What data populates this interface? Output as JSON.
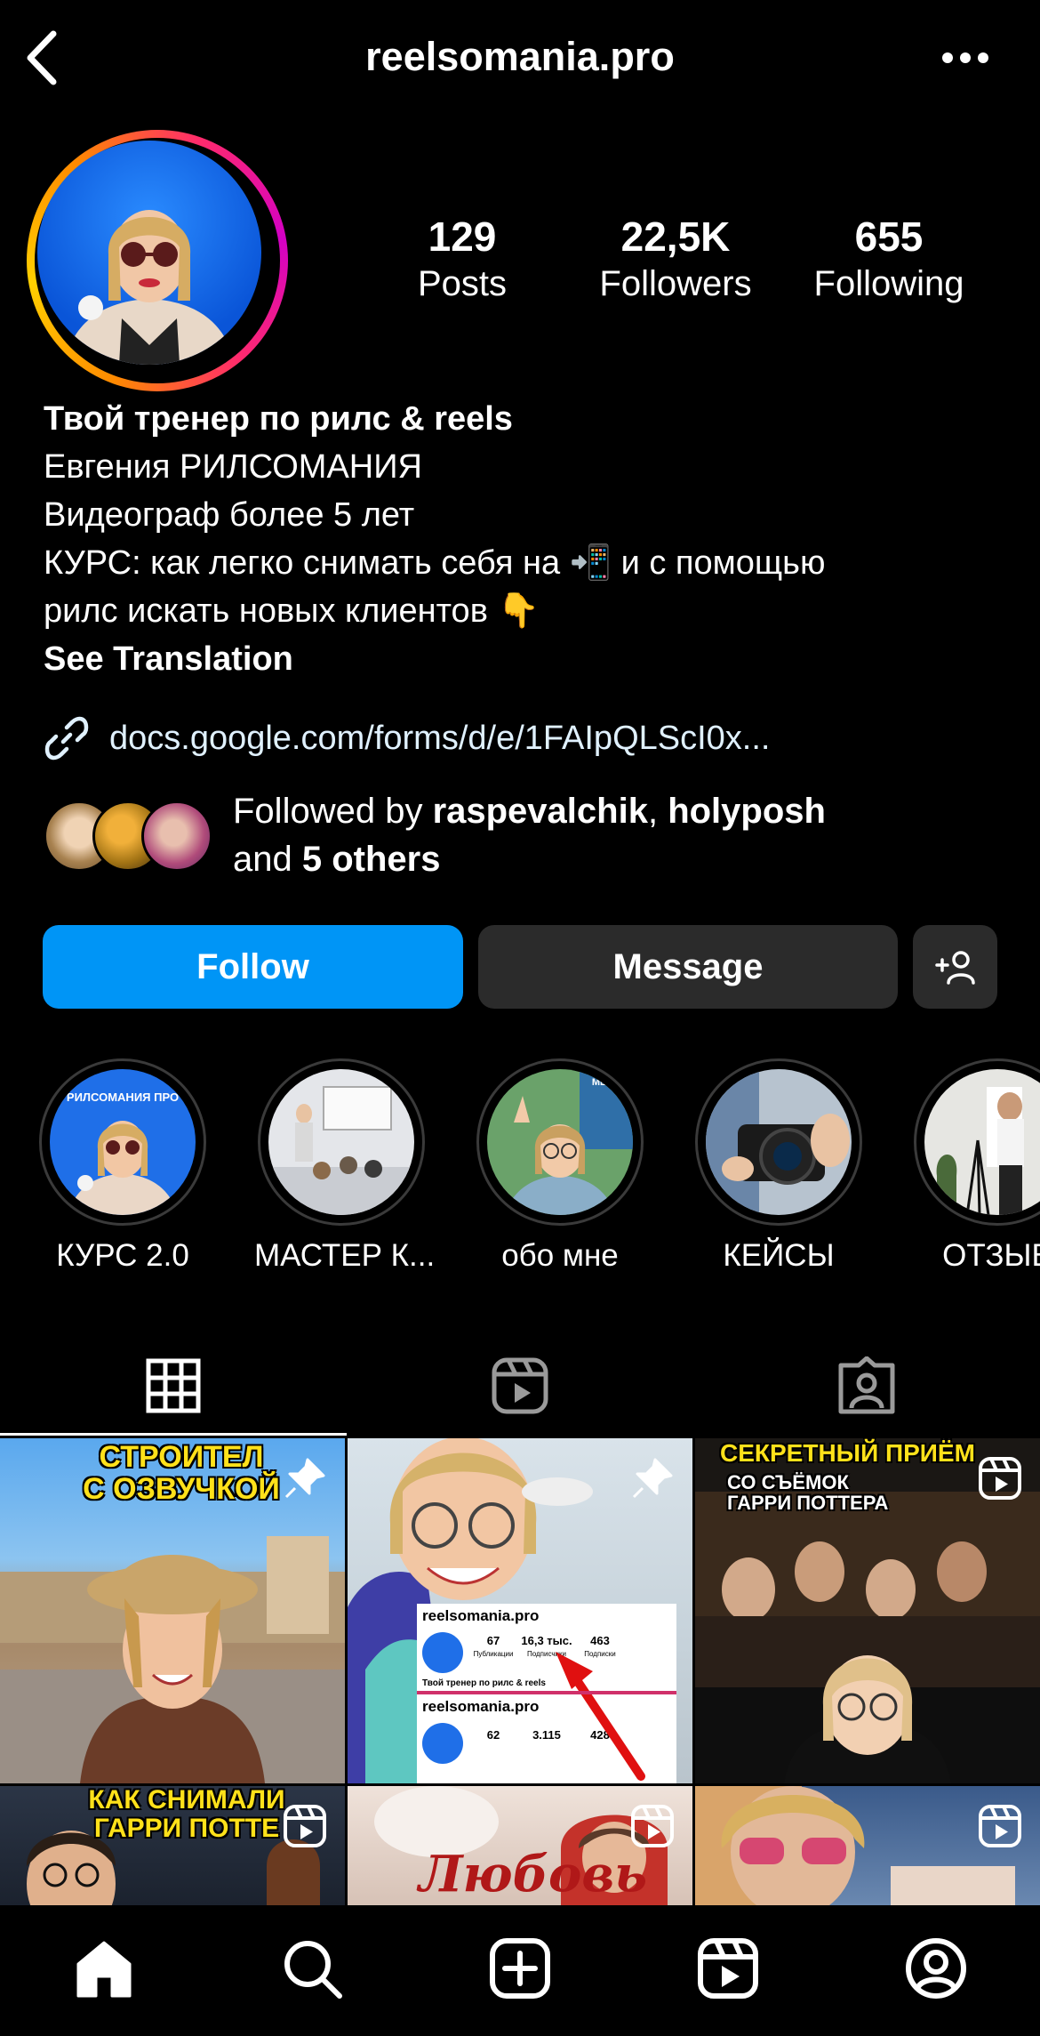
{
  "header": {
    "username": "reelsomania.pro"
  },
  "stats": [
    {
      "value": "129",
      "label": "Posts"
    },
    {
      "value": "22,5K",
      "label": "Followers"
    },
    {
      "value": "655",
      "label": "Following"
    }
  ],
  "bio": {
    "name": "Твой тренер по рилс & reels",
    "lines": [
      "Евгения РИЛСОМАНИЯ",
      "Видеограф более 5 лет",
      "КУРС: как легко снимать себя на 📲 и с помощью",
      "рилс искать новых клиентов 👇"
    ],
    "see_translation": "See Translation",
    "link": "docs.google.com/forms/d/e/1FAIpQLScI0x..."
  },
  "followed_by": {
    "prefix": "Followed by ",
    "user1": "raspevalchik",
    "sep": ", ",
    "user2": "holyposh",
    "and": "and ",
    "others": "5 others"
  },
  "buttons": {
    "follow": "Follow",
    "message": "Message"
  },
  "highlights": [
    {
      "label": "КУРС 2.0",
      "cover_text": "РИЛСОМАНИЯ ПРО"
    },
    {
      "label": "МАСТЕР К..."
    },
    {
      "label": "обо мне",
      "cover_text": "МЕНЯ"
    },
    {
      "label": "КЕЙСЫ"
    },
    {
      "label": "ОТЗЫВ"
    }
  ],
  "posts": [
    {
      "caption": "СТРОИТЕЛ\nС ОЗВУЧКОЙ",
      "badge": "pin-icon"
    },
    {
      "caption": "",
      "badge": "pin-icon",
      "inner": {
        "username": "reelsomania.pro",
        "stats": [
          "67",
          "16,3 тыс.",
          "463"
        ],
        "stat_labels": [
          "Публикации",
          "Подписчики",
          "Подписки"
        ],
        "bio": "Твой тренер по рилс & reels",
        "username2": "reelsomania.pro",
        "stats2": [
          "62",
          "3.115",
          "428"
        ]
      }
    },
    {
      "caption": "СЕКРЕТНЫЙ ПРИЁМ",
      "sub": "СО СЪЁМОК\nГАРРИ ПОТТЕРА",
      "badge": "reels-icon"
    },
    {
      "caption": "КАК СНИМАЛИ\nГАРРИ ПОТТЕ",
      "badge": "reels-icon"
    },
    {
      "caption": "Любовь",
      "badge": "reels-icon"
    },
    {
      "caption": "",
      "badge": "reels-icon"
    }
  ],
  "colors": {
    "follow_blue": "#0095f6",
    "button_gray": "#2b2b2b",
    "caption_yellow": "#ffe11a"
  }
}
